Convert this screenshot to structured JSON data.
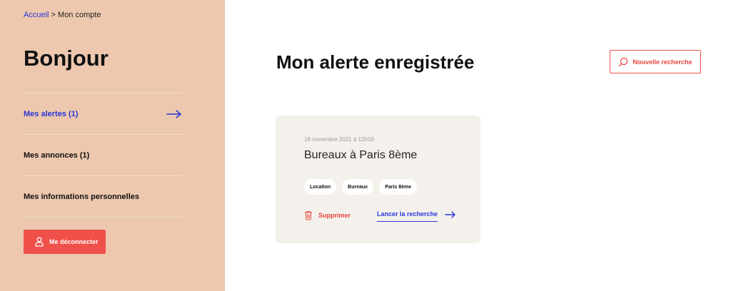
{
  "breadcrumb": {
    "home": "Accueil",
    "separator": ">",
    "current": "Mon compte"
  },
  "sidebar": {
    "greeting": "Bonjour",
    "items": [
      {
        "label": "Mes alertes (1)",
        "active": true
      },
      {
        "label": "Mes annonces (1)",
        "active": false
      },
      {
        "label": "Mes informations personnelles",
        "active": false
      }
    ],
    "logout_label": "Me déconnecter"
  },
  "main": {
    "title": "Mon alerte enregistrée",
    "new_search_label": "Nouvelle recherche",
    "alert": {
      "date": "18 novembre 2021 à 12h59",
      "title": "Bureaux à Paris 8ème",
      "tags": [
        "Location",
        "Bureaux",
        "Paris 8ème"
      ],
      "delete_label": "Supprimer",
      "launch_label": "Lancer la recherche"
    }
  },
  "colors": {
    "sidebar_bg": "#edc8ae",
    "accent_blue": "#2a35d9",
    "accent_red": "#f0504a",
    "card_bg": "#f4f1ec"
  },
  "icons": {
    "active_item": "arrow-right-icon",
    "logout": "user-icon",
    "new_search": "search-icon",
    "delete": "trash-icon",
    "launch": "arrow-right-icon"
  }
}
